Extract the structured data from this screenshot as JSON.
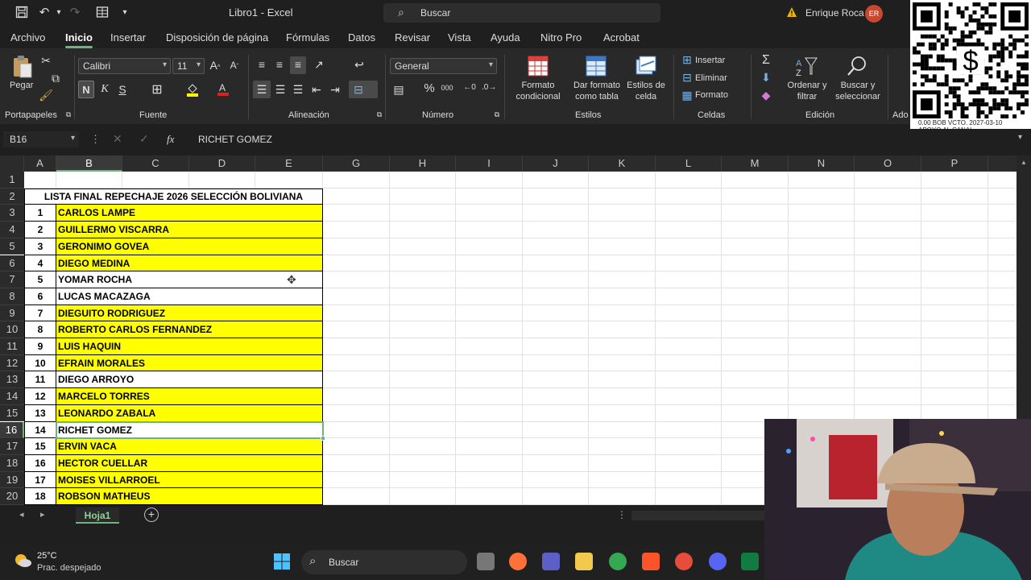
{
  "titlebar": {
    "doc_title": "Libro1  -  Excel",
    "search_placeholder": "Buscar",
    "user_name": "Enrique Roca",
    "user_initials": "ER"
  },
  "menu": {
    "tabs": [
      "Archivo",
      "Inicio",
      "Insertar",
      "Disposición de página",
      "Fórmulas",
      "Datos",
      "Revisar",
      "Vista",
      "Ayuda",
      "Nitro Pro",
      "Acrobat"
    ],
    "active": "Inicio"
  },
  "ribbon": {
    "clipboard": {
      "paste": "Pegar",
      "group": "Portapapeles"
    },
    "font": {
      "name": "Calibri",
      "size": "11",
      "group": "Fuente",
      "bold": "N",
      "italic": "K",
      "underline": "S"
    },
    "alignment": {
      "group": "Alineación"
    },
    "number": {
      "format": "General",
      "group": "Número"
    },
    "styles": {
      "conditional": "Formato condicional",
      "as_table": "Dar formato como tabla",
      "cell_styles": "Estilos de celda",
      "group": "Estilos"
    },
    "cells": {
      "insert": "Insertar",
      "delete": "Eliminar",
      "format": "Formato",
      "group": "Celdas"
    },
    "editing": {
      "sort": "Ordenar y filtrar",
      "find": "Buscar y seleccionar",
      "group": "Edición"
    },
    "addins_group": "Ado"
  },
  "qr_overlay": {
    "line1": "0.00 BOB  VCTO. 2027-03-10",
    "line2": "APOYO AL CANAL"
  },
  "formula_bar": {
    "name_box": "B16",
    "fx": "fx",
    "content": "RICHET GOMEZ"
  },
  "grid": {
    "columns": [
      "A",
      "B",
      "C",
      "D",
      "E",
      "G",
      "H",
      "I",
      "J",
      "K",
      "L",
      "M",
      "N",
      "O",
      "P"
    ],
    "rows": [
      "1",
      "2",
      "3",
      "4",
      "5",
      "6",
      "7",
      "8",
      "9",
      "10",
      "11",
      "12",
      "13",
      "14",
      "15",
      "16",
      "17",
      "18",
      "19",
      "20"
    ],
    "title": "LISTA FINAL REPECHAJE 2026 SELECCIÓN BOLIVIANA",
    "players": [
      {
        "num": "1",
        "name": "CARLOS LAMPE",
        "yellow": true
      },
      {
        "num": "2",
        "name": "GUILLERMO VISCARRA",
        "yellow": true
      },
      {
        "num": "3",
        "name": "GERONIMO GOVEA",
        "yellow": true
      },
      {
        "num": "4",
        "name": "DIEGO MEDINA",
        "yellow": true
      },
      {
        "num": "5",
        "name": "YOMAR ROCHA",
        "yellow": false
      },
      {
        "num": "6",
        "name": "LUCAS MACAZAGA",
        "yellow": false
      },
      {
        "num": "7",
        "name": "DIEGUITO RODRIGUEZ",
        "yellow": true
      },
      {
        "num": "8",
        "name": "ROBERTO CARLOS FERNANDEZ",
        "yellow": true
      },
      {
        "num": "9",
        "name": "LUIS HAQUIN",
        "yellow": true
      },
      {
        "num": "10",
        "name": "EFRAIN MORALES",
        "yellow": true
      },
      {
        "num": "11",
        "name": "DIEGO ARROYO",
        "yellow": false
      },
      {
        "num": "12",
        "name": "MARCELO TORRES",
        "yellow": true
      },
      {
        "num": "13",
        "name": "LEONARDO ZABALA",
        "yellow": true
      },
      {
        "num": "14",
        "name": "RICHET GOMEZ",
        "yellow": false
      },
      {
        "num": "15",
        "name": "ERVIN VACA",
        "yellow": true
      },
      {
        "num": "16",
        "name": "HECTOR CUELLAR",
        "yellow": true
      },
      {
        "num": "17",
        "name": "MOISES VILLARROEL",
        "yellow": true
      },
      {
        "num": "18",
        "name": "ROBSON MATHEUS",
        "yellow": true
      }
    ],
    "selected_row": "16",
    "selected_col": "B",
    "highlight_color": "#ffff00",
    "accent_color": "#6fb37b"
  },
  "sheets": {
    "active": "Hoja1"
  },
  "taskbar": {
    "temp": "25°C",
    "weather": "Prac. despejado",
    "search": "Buscar"
  }
}
